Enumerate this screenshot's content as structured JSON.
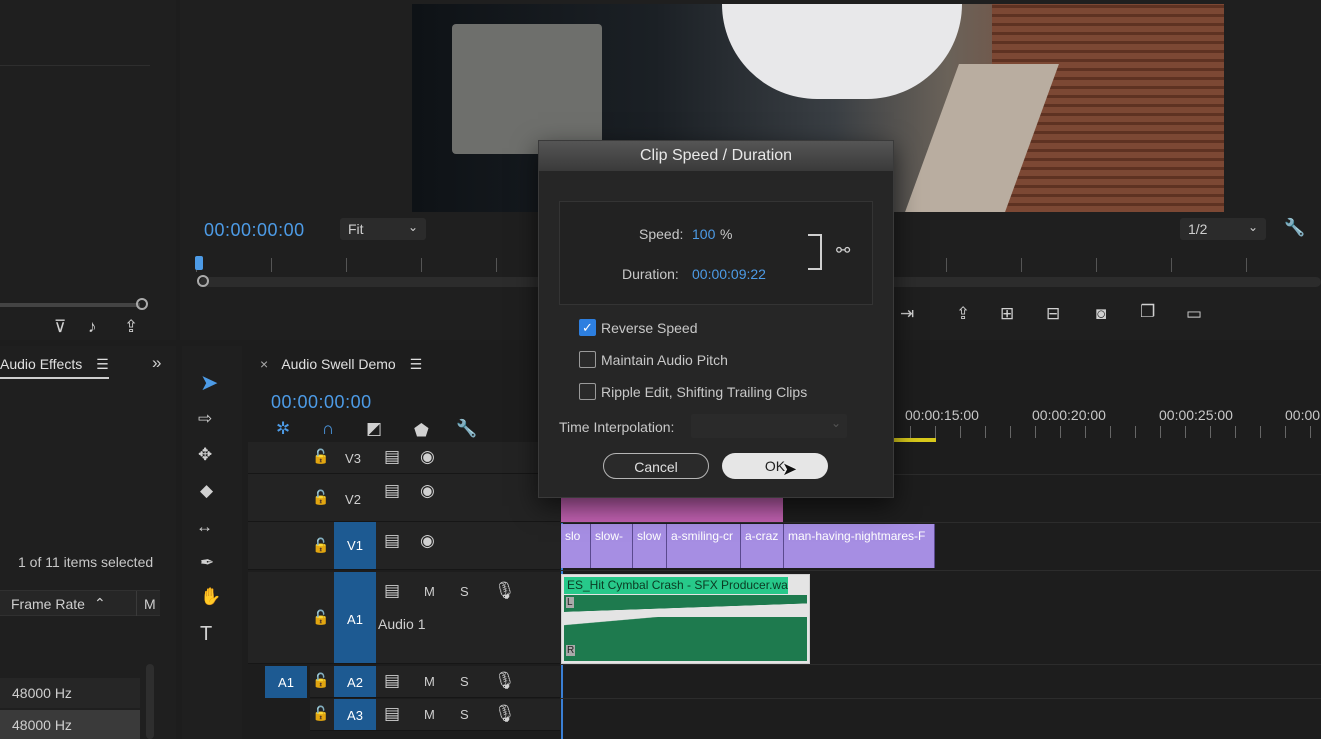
{
  "program_monitor": {
    "timecode": "00:00:00:00",
    "fit_label": "Fit",
    "resolution_label": "1/2"
  },
  "audio_effects_panel": {
    "tab_label": "Audio Effects",
    "items_selected": "1 of 11 items selected",
    "column_frame_rate": "Frame Rate",
    "column_m": "M",
    "rows": [
      "48000 Hz",
      "48000 Hz"
    ]
  },
  "timeline": {
    "sequence_name": "Audio Swell Demo",
    "timecode": "00:00:00:00",
    "ruler_labels": [
      "00:00:15:00",
      "00:00:20:00",
      "00:00:25:00",
      "00:00"
    ],
    "tracks": {
      "v3": "V3",
      "v2": "V2",
      "v1": "V1",
      "a1": "A1",
      "a1_name": "Audio 1",
      "a2": "A2",
      "a3": "A3",
      "source_a1": "A1",
      "mute": "M",
      "solo": "S"
    },
    "video_clips": [
      "slo",
      "slow-",
      "slow",
      "a-smiling-cr",
      "a-craz",
      "man-having-nightmares-F"
    ],
    "audio_clip": {
      "name": "ES_Hit Cymbal Crash - SFX Producer.wav",
      "channel_l": "L",
      "channel_r": "R"
    }
  },
  "dialog": {
    "title": "Clip Speed / Duration",
    "speed_label": "Speed:",
    "speed_value": "100",
    "speed_unit": "%",
    "duration_label": "Duration:",
    "duration_value": "00:00:09:22",
    "reverse_speed": {
      "label": "Reverse Speed",
      "checked": true
    },
    "maintain_pitch": {
      "label": "Maintain Audio Pitch",
      "checked": false
    },
    "ripple_edit": {
      "label": "Ripple Edit, Shifting Trailing Clips",
      "checked": false
    },
    "interpolation_label": "Time Interpolation:",
    "cancel_label": "Cancel",
    "ok_label": "OK"
  },
  "colors": {
    "accent_blue": "#4d9be6",
    "video_clip": "#a68ee3",
    "v2_clip": "#c060b0",
    "audio_clip": "#1e7a4e",
    "audio_clip_header": "#27c98a",
    "work_area": "#d8c91b"
  }
}
